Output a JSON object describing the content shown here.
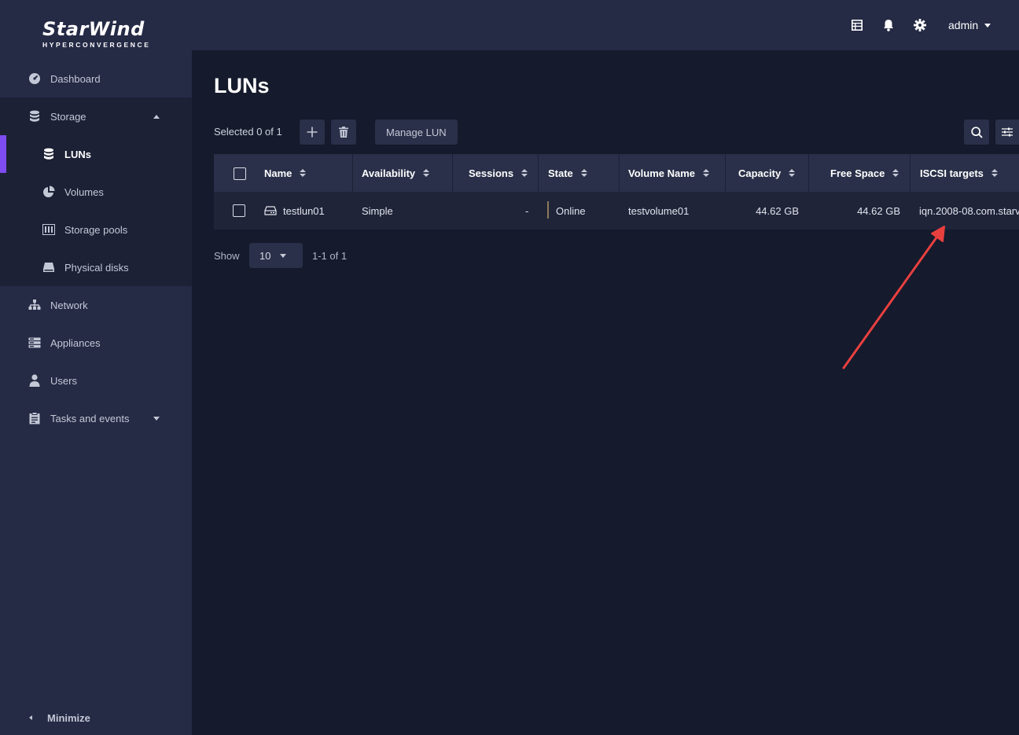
{
  "logo": {
    "main": "StarWind",
    "sub": "HYPERCONVERGENCE"
  },
  "sidebar": {
    "items": [
      {
        "label": "Dashboard",
        "icon": "dashboard-gauge-icon"
      },
      {
        "label": "Storage",
        "icon": "database-icon"
      },
      {
        "label": "LUNs",
        "icon": "database-icon"
      },
      {
        "label": "Volumes",
        "icon": "pie-chart-icon"
      },
      {
        "label": "Storage pools",
        "icon": "storage-pool-icon"
      },
      {
        "label": "Physical disks",
        "icon": "disk-icon"
      },
      {
        "label": "Network",
        "icon": "network-tree-icon"
      },
      {
        "label": "Appliances",
        "icon": "server-icon"
      },
      {
        "label": "Users",
        "icon": "user-icon"
      },
      {
        "label": "Tasks and events",
        "icon": "clipboard-icon"
      }
    ],
    "minimize_label": "Minimize"
  },
  "topbar": {
    "icons": [
      "table-icon",
      "bell-icon",
      "gear-icon"
    ],
    "user": "admin"
  },
  "page": {
    "title": "LUNs",
    "selected_text": "Selected 0 of 1",
    "manage_label": "Manage LUN"
  },
  "table": {
    "columns": [
      "Name",
      "Availability",
      "Sessions",
      "State",
      "Volume Name",
      "Capacity",
      "Free Space",
      "ISCSI targets"
    ],
    "rows": [
      {
        "name": "testlun01",
        "availability": "Simple",
        "sessions": "-",
        "state": "Online",
        "volume_name": "testvolume01",
        "capacity": "44.62 GB",
        "free_space": "44.62 GB",
        "iscsi_target": "iqn.2008-08.com.starv"
      }
    ]
  },
  "pagination": {
    "show_label": "Show",
    "page_size": "10",
    "range": "1-1 of 1"
  },
  "colors": {
    "accent": "#7e4cf0",
    "annotation_arrow": "#e8403f",
    "sidebar_bg": "#252a45",
    "main_bg": "#151a2c"
  }
}
